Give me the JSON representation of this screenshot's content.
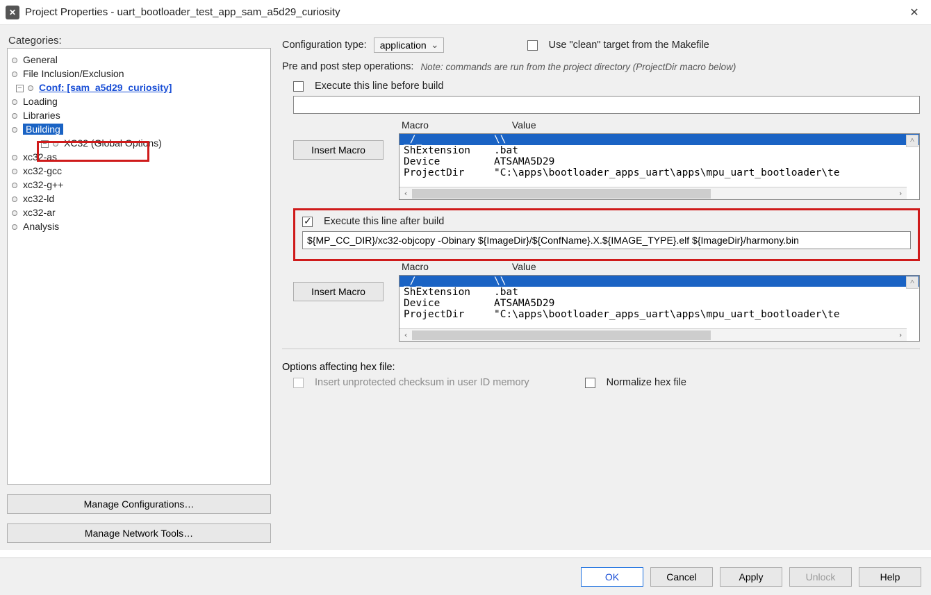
{
  "window": {
    "title": "Project Properties - uart_bootloader_test_app_sam_a5d29_curiosity"
  },
  "sidebar": {
    "heading": "Categories:",
    "items": {
      "general": "General",
      "file_incl": "File Inclusion/Exclusion",
      "conf": "Conf: [sam_a5d29_curiosity]",
      "loading": "Loading",
      "libraries": "Libraries",
      "building": "Building",
      "xc32": "XC32 (Global Options)",
      "xc32_as": "xc32-as",
      "xc32_gcc": "xc32-gcc",
      "xc32_gpp": "xc32-g++",
      "xc32_ld": "xc32-ld",
      "xc32_ar": "xc32-ar",
      "analysis": "Analysis"
    },
    "buttons": {
      "manage_conf": "Manage Configurations…",
      "manage_tools": "Manage Network Tools…"
    }
  },
  "main": {
    "config_type_label": "Configuration type:",
    "config_type_value": "application",
    "use_clean_label": "Use \"clean\" target from the Makefile",
    "pre_post_label": "Pre and post step operations:",
    "pre_post_note": "Note: commands are run from the project directory (ProjectDir macro below)",
    "exec_before_label": "Execute this line before build",
    "exec_before_value": "",
    "macro_header_key": "Macro",
    "macro_header_val": "Value",
    "insert_macro_btn": "Insert Macro",
    "macros": [
      {
        "k": "_/_",
        "v": "\\\\"
      },
      {
        "k": "ShExtension",
        "v": ".bat"
      },
      {
        "k": "Device",
        "v": "ATSAMA5D29"
      },
      {
        "k": "ProjectDir",
        "v": "\"C:\\apps\\bootloader_apps_uart\\apps\\mpu_uart_bootloader\\te"
      }
    ],
    "exec_after_label": "Execute this line after build",
    "exec_after_value": "${MP_CC_DIR}/xc32-objcopy -Obinary ${ImageDir}/${ConfName}.X.${IMAGE_TYPE}.elf ${ImageDir}/harmony.bin",
    "hex_section_label": "Options affecting hex file:",
    "hex_checksum_label": "Insert unprotected checksum in user ID memory",
    "hex_normalize_label": "Normalize hex file"
  },
  "footer": {
    "ok": "OK",
    "cancel": "Cancel",
    "apply": "Apply",
    "unlock": "Unlock",
    "help": "Help"
  }
}
